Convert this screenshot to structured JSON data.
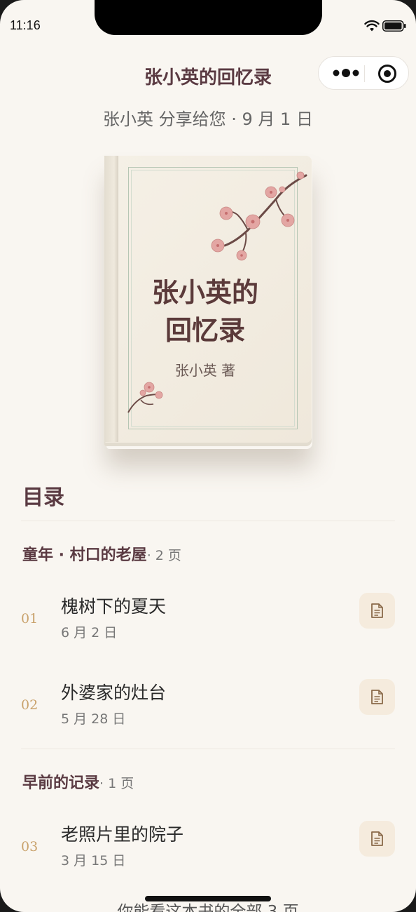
{
  "status_bar": {
    "time": "11:16"
  },
  "header": {
    "title": "张小英的回忆录"
  },
  "share_line": "张小英 分享给您 · 9 月 1 日",
  "book": {
    "title_line1": "张小英的",
    "title_line2": "回忆录",
    "author": "张小英 著"
  },
  "toc": {
    "heading": "目录",
    "sections": [
      {
        "name": "童年 · 村口的老屋",
        "count": "· 2 页",
        "entries": [
          {
            "num": "01",
            "title": "槐树下的夏天",
            "date": "6 月 2 日"
          },
          {
            "num": "02",
            "title": "外婆家的灶台",
            "date": "5 月 28 日"
          }
        ]
      },
      {
        "name": "早前的记录",
        "count": "· 1 页",
        "entries": [
          {
            "num": "03",
            "title": "老照片里的院子",
            "date": "3 月 15 日"
          }
        ]
      }
    ]
  },
  "footer_note": "你能看这本书的全部 3 页",
  "colors": {
    "accent": "#c9a26c",
    "title": "#5a3a42",
    "background": "#f9f6f1",
    "button_bg": "#f5ebdd"
  },
  "icons": [
    "wifi-icon",
    "battery-icon",
    "more-icon",
    "close-icon",
    "document-icon"
  ]
}
